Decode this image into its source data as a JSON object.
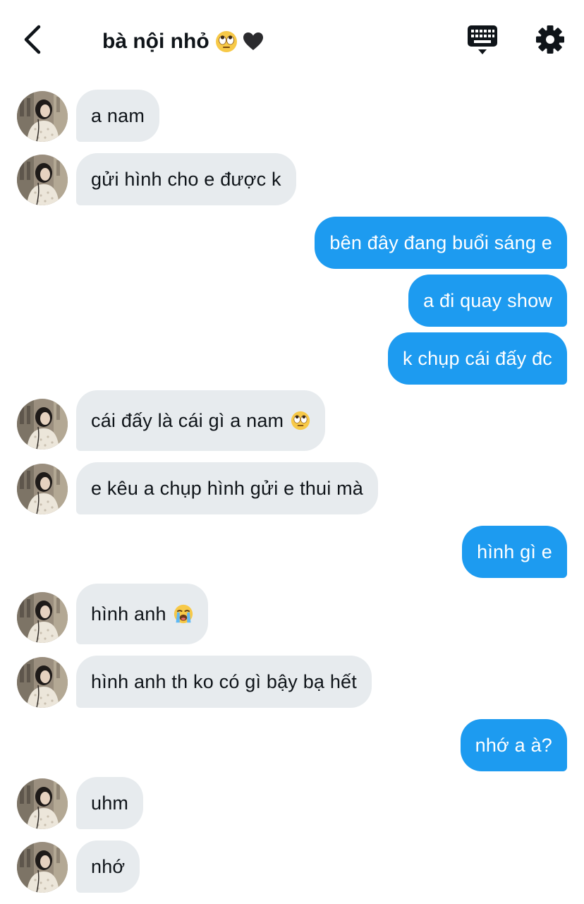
{
  "header": {
    "title": "bà nội nhỏ",
    "title_emojis": [
      "face-with-rolling-eyes-emoji",
      "black-heart-emoji"
    ],
    "back_icon": "chevron-left-icon",
    "keyboard_icon": "keyboard-icon",
    "settings_icon": "gear-icon"
  },
  "colors": {
    "incoming_bubble": "#e7ebee",
    "outgoing_bubble": "#1d9bf0",
    "text": "#0f1419"
  },
  "messages": [
    {
      "direction": "in",
      "text": "a nam"
    },
    {
      "direction": "in",
      "text": "gửi hình cho e được k"
    },
    {
      "direction": "out",
      "text": "bên đây đang buổi sáng e"
    },
    {
      "direction": "out",
      "text": "a đi quay show"
    },
    {
      "direction": "out",
      "text": "k chụp cái đấy đc"
    },
    {
      "direction": "in",
      "text": "cái đấy là cái gì a nam",
      "emoji": "face-with-rolling-eyes-emoji"
    },
    {
      "direction": "in",
      "text": "e kêu a chụp hình gửi e thui mà"
    },
    {
      "direction": "out",
      "text": "hình gì e"
    },
    {
      "direction": "in",
      "text": "hình anh",
      "emoji": "loudly-crying-face-emoji"
    },
    {
      "direction": "in",
      "text": "hình anh th ko có gì bậy bạ hết"
    },
    {
      "direction": "out",
      "text": "nhớ a à?"
    },
    {
      "direction": "in",
      "text": "uhm"
    },
    {
      "direction": "in",
      "text": "nhớ"
    }
  ]
}
